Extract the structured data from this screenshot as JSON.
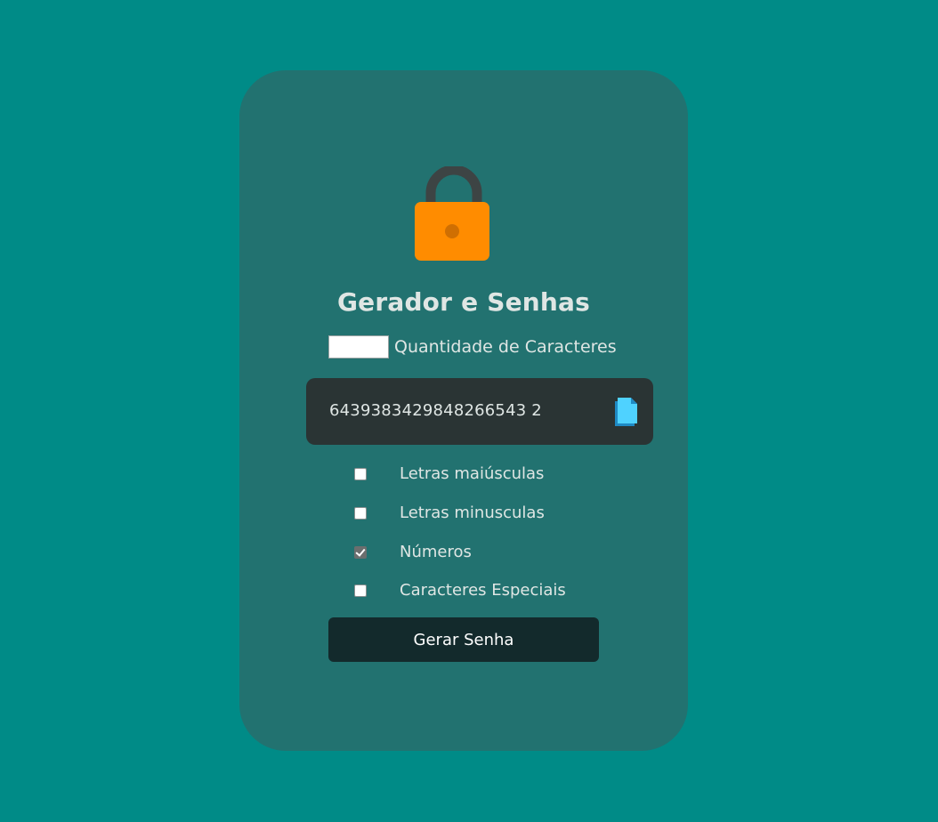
{
  "app": {
    "title": "Gerador e Senhas"
  },
  "quantity": {
    "label": "Quantidade de Caracteres",
    "value": ""
  },
  "password": {
    "value": "6439383429848266543 2",
    "copy_icon": "copy-icon"
  },
  "options": [
    {
      "label": "Letras maiúsculas",
      "checked": false
    },
    {
      "label": "Letras minusculas",
      "checked": false
    },
    {
      "label": "Números",
      "checked": true
    },
    {
      "label": "Caracteres Especiais",
      "checked": false
    }
  ],
  "button": {
    "label": "Gerar Senha"
  },
  "colors": {
    "background": "#008b87",
    "card": "#227270",
    "lock_body": "#ff8c00",
    "lock_shackle": "#3d4444",
    "password_box": "#2a3434",
    "button": "#132a2c",
    "copy_icon": "#4fd2ff"
  }
}
